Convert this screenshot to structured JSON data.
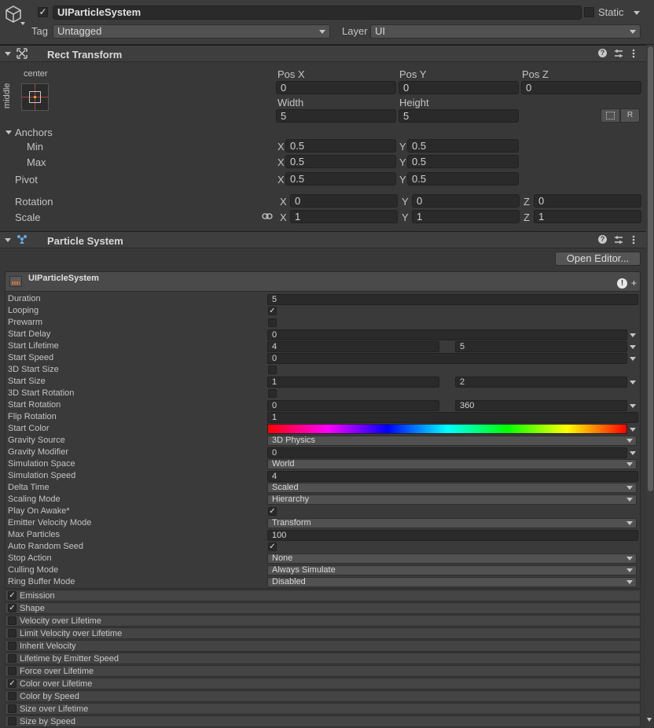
{
  "object": {
    "name": "UIParticleSystem",
    "active": true,
    "static_label": "Static",
    "tag_label": "Tag",
    "tag_value": "Untagged",
    "layer_label": "Layer",
    "layer_value": "UI"
  },
  "rect_transform": {
    "title": "Rect Transform",
    "anchor_h": "center",
    "anchor_v": "middle",
    "pos_x_label": "Pos X",
    "pos_y_label": "Pos Y",
    "pos_z_label": "Pos Z",
    "pos_x": "0",
    "pos_y": "0",
    "pos_z": "0",
    "width_label": "Width",
    "height_label": "Height",
    "width": "5",
    "height": "5",
    "raw_button": "R",
    "anchors_label": "Anchors",
    "min_label": "Min",
    "max_label": "Max",
    "pivot_label": "Pivot",
    "min_x": "0.5",
    "min_y": "0.5",
    "max_x": "0.5",
    "max_y": "0.5",
    "pivot_x": "0.5",
    "pivot_y": "0.5",
    "rotation_label": "Rotation",
    "scale_label": "Scale",
    "rot_x": "0",
    "rot_y": "0",
    "rot_z": "0",
    "scale_x": "1",
    "scale_y": "1",
    "scale_z": "1",
    "axis_x": "X",
    "axis_y": "Y",
    "axis_z": "Z"
  },
  "particle_system": {
    "title": "Particle System",
    "open_editor": "Open Editor...",
    "module_title": "UIParticleSystem",
    "props": {
      "duration": {
        "label": "Duration",
        "value": "5"
      },
      "looping": {
        "label": "Looping",
        "checked": true
      },
      "prewarm": {
        "label": "Prewarm",
        "checked": false
      },
      "start_delay": {
        "label": "Start Delay",
        "value": "0"
      },
      "start_lifetime": {
        "label": "Start Lifetime",
        "min": "4",
        "max": "5"
      },
      "start_speed": {
        "label": "Start Speed",
        "value": "0"
      },
      "start_size_3d": {
        "label": "3D Start Size",
        "checked": false
      },
      "start_size": {
        "label": "Start Size",
        "min": "1",
        "max": "2"
      },
      "start_rotation_3d": {
        "label": "3D Start Rotation",
        "checked": false
      },
      "start_rotation": {
        "label": "Start Rotation",
        "min": "0",
        "max": "360"
      },
      "flip_rotation": {
        "label": "Flip Rotation",
        "value": "1"
      },
      "start_color": {
        "label": "Start Color",
        "gradient": [
          "#ff0000",
          "#ff00ff",
          "#0000ff",
          "#00ffff",
          "#00ff00",
          "#ffff00",
          "#ff0000"
        ]
      },
      "gravity_source": {
        "label": "Gravity Source",
        "value": "3D Physics"
      },
      "gravity_modifier": {
        "label": "Gravity Modifier",
        "value": "0"
      },
      "simulation_space": {
        "label": "Simulation Space",
        "value": "World"
      },
      "simulation_speed": {
        "label": "Simulation Speed",
        "value": "4"
      },
      "delta_time": {
        "label": "Delta Time",
        "value": "Scaled"
      },
      "scaling_mode": {
        "label": "Scaling Mode",
        "value": "Hierarchy"
      },
      "play_on_awake": {
        "label": "Play On Awake*",
        "checked": true
      },
      "emitter_velocity_mode": {
        "label": "Emitter Velocity Mode",
        "value": "Transform"
      },
      "max_particles": {
        "label": "Max Particles",
        "value": "100"
      },
      "auto_random_seed": {
        "label": "Auto Random Seed",
        "checked": true
      },
      "stop_action": {
        "label": "Stop Action",
        "value": "None"
      },
      "culling_mode": {
        "label": "Culling Mode",
        "value": "Always Simulate"
      },
      "ring_buffer_mode": {
        "label": "Ring Buffer Mode",
        "value": "Disabled"
      }
    },
    "modules": [
      {
        "label": "Emission",
        "enabled": true
      },
      {
        "label": "Shape",
        "enabled": true
      },
      {
        "label": "Velocity over Lifetime",
        "enabled": false
      },
      {
        "label": "Limit Velocity over Lifetime",
        "enabled": false
      },
      {
        "label": "Inherit Velocity",
        "enabled": false
      },
      {
        "label": "Lifetime by Emitter Speed",
        "enabled": false
      },
      {
        "label": "Force over Lifetime",
        "enabled": false
      },
      {
        "label": "Color over Lifetime",
        "enabled": true
      },
      {
        "label": "Color by Speed",
        "enabled": false
      },
      {
        "label": "Size over Lifetime",
        "enabled": false
      },
      {
        "label": "Size by Speed",
        "enabled": false
      }
    ]
  }
}
